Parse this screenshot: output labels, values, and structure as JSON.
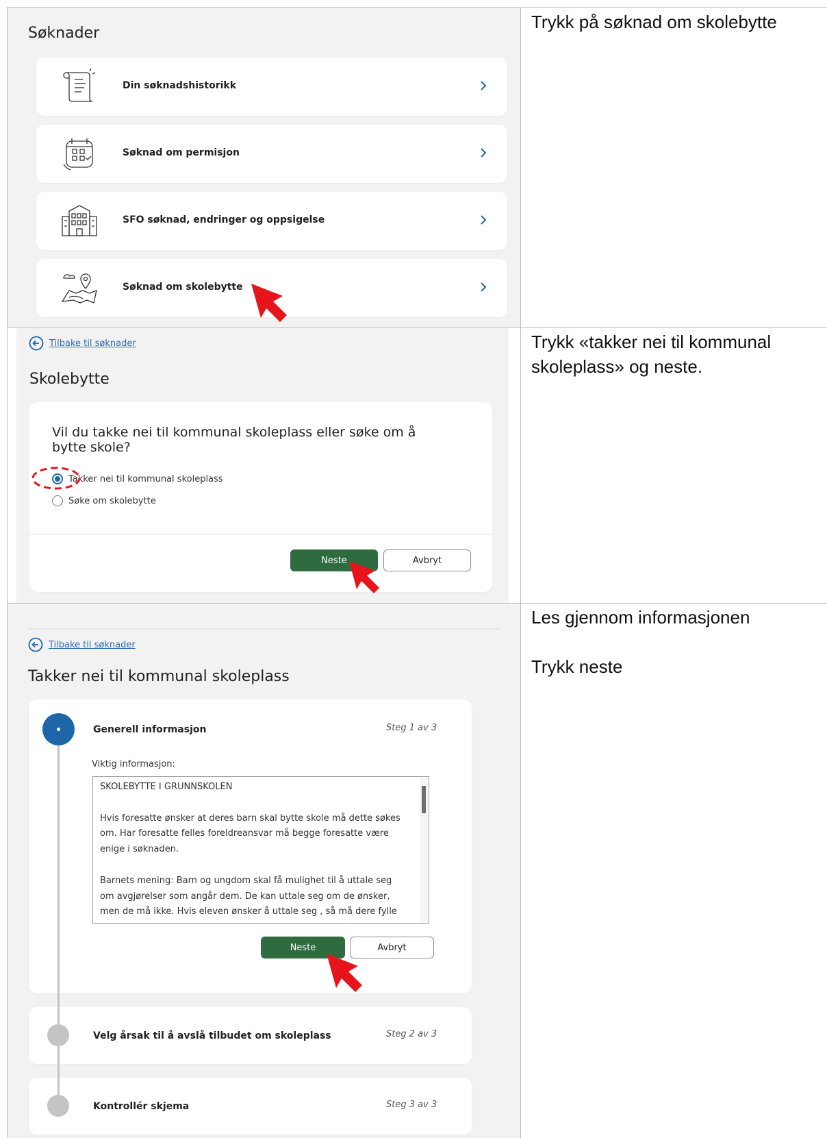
{
  "instructions": [
    "Trykk på søknad om skolebytte",
    "Trykk «takker nei til kommunal skoleplass» og neste.",
    "Les gjennom informasjonen",
    "Trykk neste"
  ],
  "panel1": {
    "title": "Søknader",
    "items": [
      {
        "label": "Din søknadshistorikk",
        "icon": "scroll-icon"
      },
      {
        "label": "Søknad om permisjon",
        "icon": "calendar-icon"
      },
      {
        "label": "SFO søknad, endringer og oppsigelse",
        "icon": "building-icon"
      },
      {
        "label": "Søknad om skolebytte",
        "icon": "map-pin-icon"
      }
    ]
  },
  "panel2": {
    "back_link": "Tilbake til søknader",
    "title": "Skolebytte",
    "question": "Vil du takke nei til kommunal skoleplass eller søke om å bytte skole?",
    "options": [
      {
        "label": "Takker nei til kommunal skoleplass",
        "selected": true
      },
      {
        "label": "Søke om skolebytte",
        "selected": false
      }
    ],
    "next_label": "Neste",
    "cancel_label": "Avbryt"
  },
  "panel3": {
    "back_link": "Tilbake til søknader",
    "title": "Takker nei til kommunal skoleplass",
    "steps": [
      {
        "title": "Generell informasjon",
        "count": "Steg 1 av 3",
        "active": true
      },
      {
        "title": "Velg årsak til å avslå tilbudet om skoleplass",
        "count": "Steg 2 av 3",
        "active": false
      },
      {
        "title": "Kontrollér skjema",
        "count": "Steg 3 av 3",
        "active": false
      }
    ],
    "info_label": "Viktig informasjon:",
    "info_text": [
      "SKOLEBYTTE I GRUNNSKOLEN",
      "Hvis foresatte ønsker at deres barn skal bytte skole må dette søkes om. Har foresatte felles foreldreansvar må begge foresatte være enige i søknaden.",
      "Barnets mening: Barn og ungdom skal få mulighet til å uttale seg om avgjørelser som angår dem. De kan uttale seg om de ønsker, men de må ikke. Hvis eleven ønsker å uttale seg , så må dere fylle inn dette i"
    ],
    "next_label": "Neste",
    "cancel_label": "Avbryt"
  },
  "colors": {
    "primary_button": "#2e6b3f",
    "link": "#2b6cb0",
    "step_active": "#1d66a8",
    "step_inactive": "#c4c4c4",
    "pointer_arrow": "#e8141b"
  }
}
